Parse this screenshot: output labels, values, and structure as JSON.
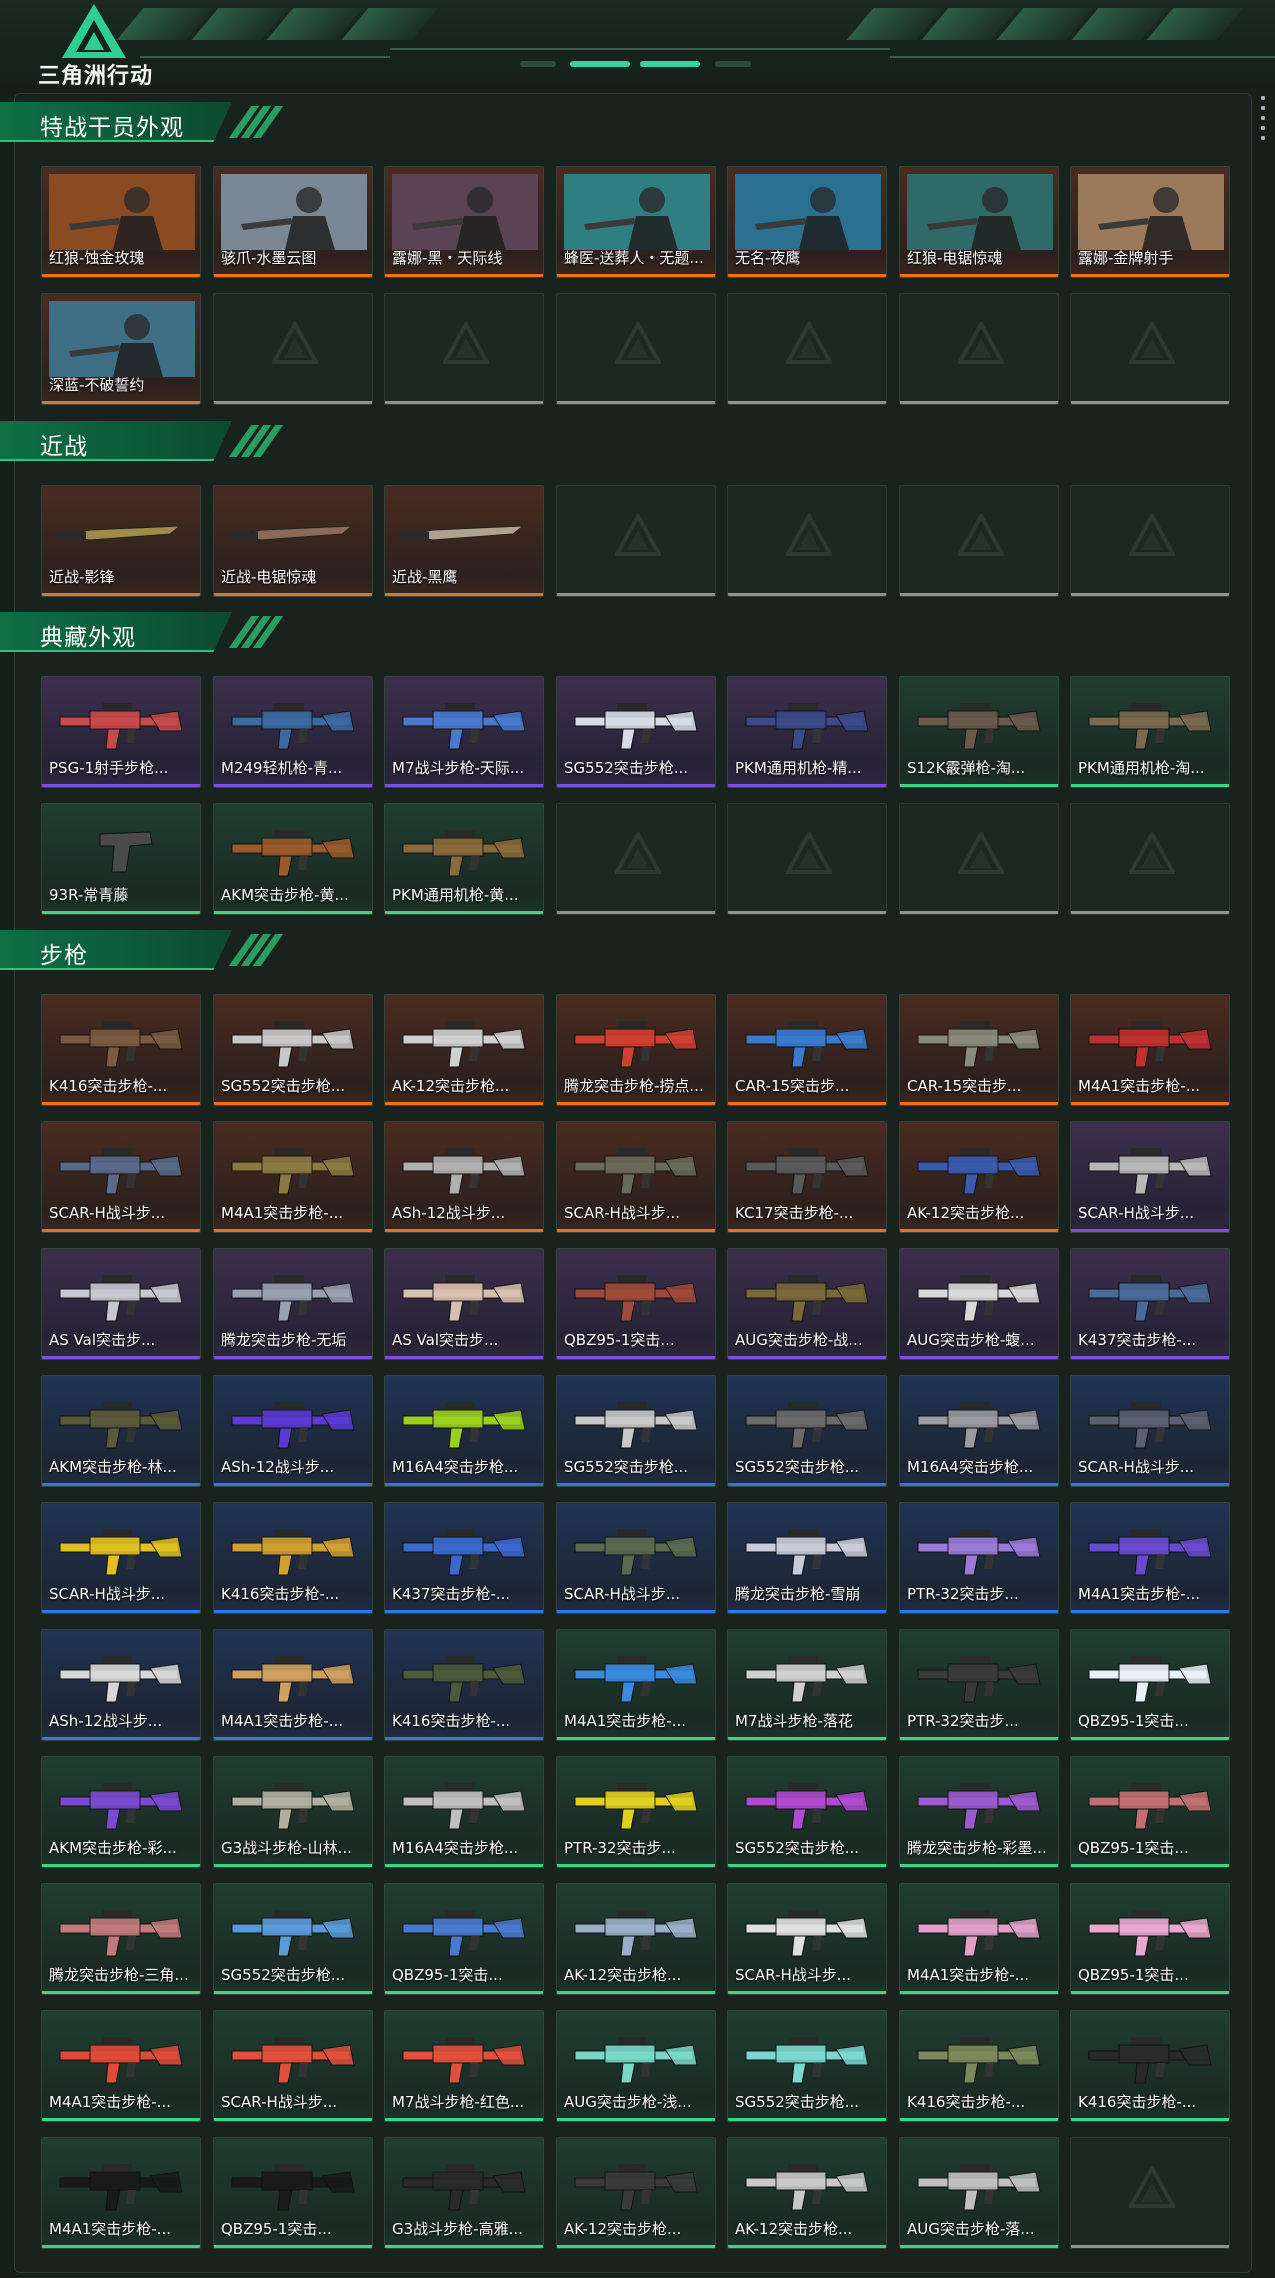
{
  "app": {
    "logo_text": "三角洲行动"
  },
  "sections": [
    {
      "title": "特战干员外观",
      "rows": [
        [
          {
            "name": "红狼-蚀金玫瑰",
            "quality": "orange",
            "kind": "portrait",
            "tint": "#8a4a22"
          },
          {
            "name": "骇爪-水墨云图",
            "quality": "orange",
            "kind": "portrait",
            "tint": "#7a8794"
          },
          {
            "name": "露娜-黑・天际线",
            "quality": "orange",
            "kind": "portrait",
            "tint": "#5a4454"
          },
          {
            "name": "蜂医-送葬人・无题...",
            "quality": "orange",
            "kind": "portrait",
            "tint": "#2f7f82"
          },
          {
            "name": "无名-夜鹰",
            "quality": "orange",
            "kind": "portrait",
            "tint": "#2b7090"
          },
          {
            "name": "红狼-电锯惊魂",
            "quality": "orange",
            "kind": "portrait",
            "tint": "#2f6a68"
          },
          {
            "name": "露娜-金牌射手",
            "quality": "orange",
            "kind": "portrait",
            "tint": "#9a7a5a"
          }
        ],
        [
          {
            "name": "深蓝-不破誓约",
            "quality": "orange",
            "kind": "portrait",
            "tint": "#3f6f86"
          },
          {
            "empty": true
          },
          {
            "empty": true
          },
          {
            "empty": true
          },
          {
            "empty": true
          },
          {
            "empty": true
          },
          {
            "empty": true
          }
        ]
      ]
    },
    {
      "title": "近战",
      "rows": [
        [
          {
            "name": "近战-影锋",
            "quality": "orange",
            "kind": "knife",
            "tint": "#a08a4a"
          },
          {
            "name": "近战-电锯惊魂",
            "quality": "orange",
            "kind": "knife",
            "tint": "#8a6a5a"
          },
          {
            "name": "近战-黑鹰",
            "quality": "orange",
            "kind": "knife",
            "tint": "#b0a090"
          },
          {
            "empty": true
          },
          {
            "empty": true
          },
          {
            "empty": true
          },
          {
            "empty": true
          }
        ]
      ]
    },
    {
      "title": "典藏外观",
      "rows": [
        [
          {
            "name": "PSG-1射手步枪...",
            "quality": "purple",
            "kind": "gun",
            "tint": "#c84a4a"
          },
          {
            "name": "M249轻机枪-青...",
            "quality": "purple",
            "kind": "gun",
            "tint": "#3a6aa0"
          },
          {
            "name": "M7战斗步枪-天际...",
            "quality": "purple",
            "kind": "gun",
            "tint": "#4a7ad0"
          },
          {
            "name": "SG552突击步枪...",
            "quality": "purple",
            "kind": "gun",
            "tint": "#d8dce8"
          },
          {
            "name": "PKM通用机枪-精...",
            "quality": "purple",
            "kind": "gun",
            "tint": "#3a4a8a"
          },
          {
            "name": "S12K霰弹枪-淘...",
            "quality": "green",
            "kind": "gun",
            "tint": "#6a5a4a"
          },
          {
            "name": "PKM通用机枪-淘...",
            "quality": "green",
            "kind": "gun",
            "tint": "#7a6a50"
          }
        ],
        [
          {
            "name": "93R-常青藤",
            "quality": "green",
            "kind": "pistol",
            "tint": "#4a4a4a"
          },
          {
            "name": "AKM突击步枪-黄...",
            "quality": "green",
            "kind": "gun",
            "tint": "#9a5a2a"
          },
          {
            "name": "PKM通用机枪-黄...",
            "quality": "green",
            "kind": "gun",
            "tint": "#8a6a3a"
          },
          {
            "empty": true
          },
          {
            "empty": true
          },
          {
            "empty": true
          },
          {
            "empty": true
          }
        ]
      ]
    },
    {
      "title": "步枪",
      "rows": [
        [
          {
            "name": "K416突击步枪-...",
            "quality": "orange",
            "kind": "gun",
            "tint": "#7a5a40"
          },
          {
            "name": "SG552突击步枪...",
            "quality": "orange",
            "kind": "gun",
            "tint": "#c8c8c8"
          },
          {
            "name": "AK-12突击步枪...",
            "quality": "orange",
            "kind": "gun",
            "tint": "#d0d0d0"
          },
          {
            "name": "腾龙突击步枪-捞点...",
            "quality": "orange",
            "kind": "gun",
            "tint": "#d04030"
          },
          {
            "name": "CAR-15突击步...",
            "quality": "orange",
            "kind": "gun",
            "tint": "#3a7ad0"
          },
          {
            "name": "CAR-15突击步...",
            "quality": "orange",
            "kind": "gun",
            "tint": "#8a8a7a"
          },
          {
            "name": "M4A1突击步枪-...",
            "quality": "orange",
            "kind": "gun",
            "tint": "#c03030"
          }
        ],
        [
          {
            "name": "SCAR-H战斗步...",
            "quality": "orange",
            "kind": "gun",
            "tint": "#5a6a8a"
          },
          {
            "name": "M4A1突击步枪-...",
            "quality": "orange",
            "kind": "gun",
            "tint": "#8a7a40"
          },
          {
            "name": "ASh-12战斗步...",
            "quality": "orange",
            "kind": "gun",
            "tint": "#b0b0b0"
          },
          {
            "name": "SCAR-H战斗步...",
            "quality": "orange",
            "kind": "gun",
            "tint": "#6a6a5a"
          },
          {
            "name": "KC17突击步枪-...",
            "quality": "orange",
            "kind": "gun",
            "tint": "#5a5a5a"
          },
          {
            "name": "AK-12突击步枪...",
            "quality": "orange",
            "kind": "gun",
            "tint": "#3a5ab0"
          },
          {
            "name": "SCAR-H战斗步...",
            "quality": "purple",
            "kind": "gun",
            "tint": "#b8b8b8"
          }
        ],
        [
          {
            "name": "AS Val突击步...",
            "quality": "purple",
            "kind": "gun",
            "tint": "#c8c8d0"
          },
          {
            "name": "腾龙突击步枪-无垢",
            "quality": "purple",
            "kind": "gun",
            "tint": "#9aa0b0"
          },
          {
            "name": "AS Val突击步...",
            "quality": "purple",
            "kind": "gun",
            "tint": "#d8c0b0"
          },
          {
            "name": "QBZ95-1突击...",
            "quality": "purple",
            "kind": "gun",
            "tint": "#a04a3a"
          },
          {
            "name": "AUG突击步枪-战...",
            "quality": "purple",
            "kind": "gun",
            "tint": "#7a6a3a"
          },
          {
            "name": "AUG突击步枪-蝮...",
            "quality": "purple",
            "kind": "gun",
            "tint": "#d8d8d8"
          },
          {
            "name": "K437突击步枪-...",
            "quality": "purple",
            "kind": "gun",
            "tint": "#4a6a9a"
          }
        ],
        [
          {
            "name": "AKM突击步枪-林...",
            "quality": "blue",
            "kind": "gun",
            "tint": "#5a5a3a"
          },
          {
            "name": "ASh-12战斗步...",
            "quality": "blue",
            "kind": "gun",
            "tint": "#5a3ad0"
          },
          {
            "name": "M16A4突击步枪...",
            "quality": "blue",
            "kind": "gun",
            "tint": "#9ad020"
          },
          {
            "name": "SG552突击步枪...",
            "quality": "blue",
            "kind": "gun",
            "tint": "#c8c8c8"
          },
          {
            "name": "SG552突击步枪...",
            "quality": "blue",
            "kind": "gun",
            "tint": "#6a6a6a"
          },
          {
            "name": "M16A4突击步枪...",
            "quality": "blue",
            "kind": "gun",
            "tint": "#9a9aa0"
          },
          {
            "name": "SCAR-H战斗步...",
            "quality": "blue",
            "kind": "gun",
            "tint": "#5a6070"
          }
        ],
        [
          {
            "name": "SCAR-H战斗步...",
            "quality": "blue",
            "kind": "gun",
            "tint": "#e0c020"
          },
          {
            "name": "K416突击步枪-...",
            "quality": "blue",
            "kind": "gun",
            "tint": "#d0a030"
          },
          {
            "name": "K437突击步枪-...",
            "quality": "blue",
            "kind": "gun",
            "tint": "#3a6ad0"
          },
          {
            "name": "SCAR-H战斗步...",
            "quality": "blue",
            "kind": "gun",
            "tint": "#5a6a50"
          },
          {
            "name": "腾龙突击步枪-雪崩",
            "quality": "blue",
            "kind": "gun",
            "tint": "#c8ccd8"
          },
          {
            "name": "PTR-32突击步...",
            "quality": "blue",
            "kind": "gun",
            "tint": "#9a7ad8"
          },
          {
            "name": "M4A1突击步枪-...",
            "quality": "blue",
            "kind": "gun",
            "tint": "#6a4ad0"
          }
        ],
        [
          {
            "name": "ASh-12战斗步...",
            "quality": "blue",
            "kind": "gun",
            "tint": "#d8d8d8"
          },
          {
            "name": "M4A1突击步枪-...",
            "quality": "blue",
            "kind": "gun",
            "tint": "#d0a060"
          },
          {
            "name": "K416突击步枪-...",
            "quality": "blue",
            "kind": "gun",
            "tint": "#4a5a3a"
          },
          {
            "name": "M4A1突击步枪-...",
            "quality": "green",
            "kind": "gun",
            "tint": "#3a8ae0"
          },
          {
            "name": "M7战斗步枪-落花",
            "quality": "green",
            "kind": "gun",
            "tint": "#d0d0d0"
          },
          {
            "name": "PTR-32突击步...",
            "quality": "green",
            "kind": "gun",
            "tint": "#3a3a3a"
          },
          {
            "name": "QBZ95-1突击...",
            "quality": "green",
            "kind": "gun",
            "tint": "#e8f0f8"
          }
        ],
        [
          {
            "name": "AKM突击步枪-彩...",
            "quality": "green",
            "kind": "gun",
            "tint": "#7a4ad0"
          },
          {
            "name": "G3战斗步枪-山林...",
            "quality": "green",
            "kind": "gun",
            "tint": "#b0b0a0"
          },
          {
            "name": "M16A4突击步枪...",
            "quality": "green",
            "kind": "gun",
            "tint": "#c0c0c0"
          },
          {
            "name": "PTR-32突击步...",
            "quality": "green",
            "kind": "gun",
            "tint": "#e0d020"
          },
          {
            "name": "SG552突击步枪...",
            "quality": "green",
            "kind": "gun",
            "tint": "#b04ad0"
          },
          {
            "name": "腾龙突击步枪-彩墨...",
            "quality": "green",
            "kind": "gun",
            "tint": "#9a5ad0"
          },
          {
            "name": "QBZ95-1突击...",
            "quality": "green",
            "kind": "gun",
            "tint": "#c07070"
          }
        ],
        [
          {
            "name": "腾龙突击步枪-三角...",
            "quality": "green",
            "kind": "gun",
            "tint": "#c07a7a"
          },
          {
            "name": "SG552突击步枪...",
            "quality": "green",
            "kind": "gun",
            "tint": "#5a9ad8"
          },
          {
            "name": "QBZ95-1突击...",
            "quality": "green",
            "kind": "gun",
            "tint": "#4a7ad0"
          },
          {
            "name": "AK-12突击步枪...",
            "quality": "green",
            "kind": "gun",
            "tint": "#9ab0c8"
          },
          {
            "name": "SCAR-H战斗步...",
            "quality": "green",
            "kind": "gun",
            "tint": "#e0e0e0"
          },
          {
            "name": "M4A1突击步枪-...",
            "quality": "green",
            "kind": "gun",
            "tint": "#e0a0c8"
          },
          {
            "name": "QBZ95-1突击...",
            "quality": "green",
            "kind": "gun",
            "tint": "#e8a8d0"
          }
        ],
        [
          {
            "name": "M4A1突击步枪-...",
            "quality": "green",
            "kind": "gun",
            "tint": "#e04a3a"
          },
          {
            "name": "SCAR-H战斗步...",
            "quality": "green",
            "kind": "gun",
            "tint": "#e0503a"
          },
          {
            "name": "M7战斗步枪-红色...",
            "quality": "green",
            "kind": "gun",
            "tint": "#e0503a"
          },
          {
            "name": "AUG突击步枪-浅...",
            "quality": "green",
            "kind": "gun",
            "tint": "#7ad8c8"
          },
          {
            "name": "SG552突击步枪...",
            "quality": "green",
            "kind": "gun",
            "tint": "#7ad8d0"
          },
          {
            "name": "K416突击步枪-...",
            "quality": "green",
            "kind": "gun",
            "tint": "#7a8a5a"
          },
          {
            "name": "K416突击步枪-...",
            "quality": "green",
            "kind": "gun",
            "tint": "#2a2a2a"
          }
        ],
        [
          {
            "name": "M4A1突击步枪-...",
            "quality": "green",
            "kind": "gun",
            "tint": "#1a1a1a"
          },
          {
            "name": "QBZ95-1突击...",
            "quality": "green",
            "kind": "gun",
            "tint": "#1a1a1a"
          },
          {
            "name": "G3战斗步枪-高雅...",
            "quality": "green",
            "kind": "gun",
            "tint": "#2a2a2a"
          },
          {
            "name": "AK-12突击步枪...",
            "quality": "green",
            "kind": "gun",
            "tint": "#3a3a3a"
          },
          {
            "name": "AK-12突击步枪...",
            "quality": "green",
            "kind": "gun",
            "tint": "#c8c8c8"
          },
          {
            "name": "AUG突击步枪-落...",
            "quality": "green",
            "kind": "gun",
            "tint": "#c0c0c0"
          },
          {
            "empty": true
          }
        ]
      ]
    }
  ],
  "colors": {
    "orange": "#e8711f",
    "purple": "#7e4de1",
    "blue": "#2f77e0",
    "green": "#3bd684",
    "empty": "#8b9690",
    "accent": "#38d2a1"
  }
}
